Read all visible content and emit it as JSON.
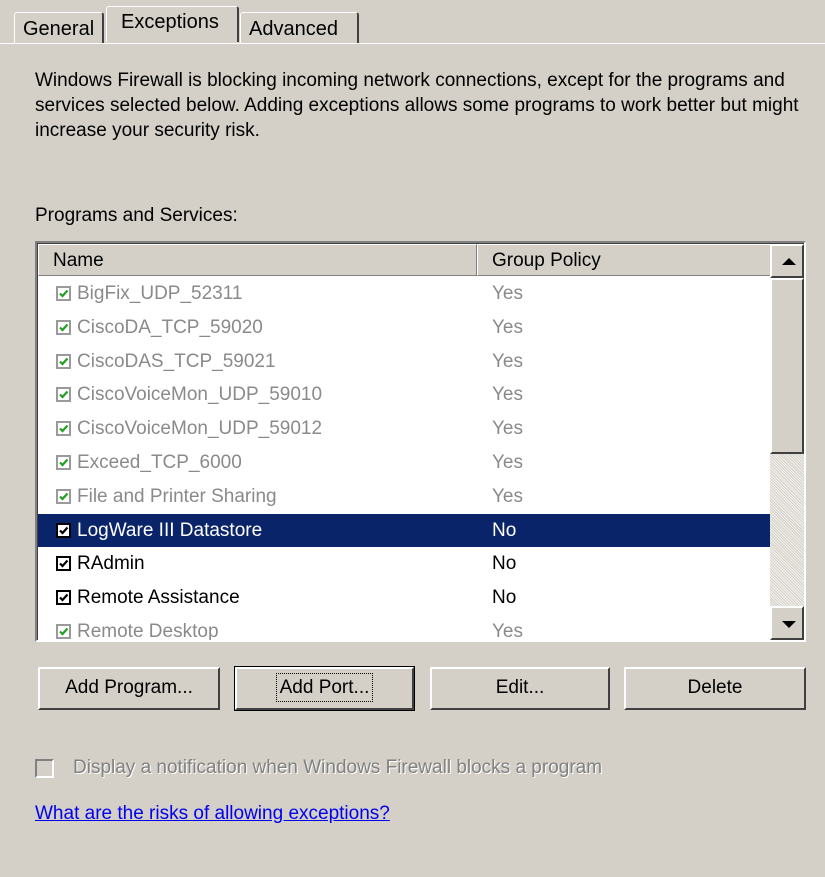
{
  "tabs": [
    {
      "label": "General"
    },
    {
      "label": "Exceptions"
    },
    {
      "label": "Advanced"
    }
  ],
  "description": "Windows Firewall is blocking incoming network connections, except for the programs and services selected below. Adding exceptions allows some programs to work better but might increase your security risk.",
  "programs_label": "Programs and Services:",
  "columns": {
    "name": "Name",
    "group_policy": "Group Policy"
  },
  "rows": [
    {
      "name": "BigFix_UDP_52311",
      "group_policy": "Yes",
      "checked": true,
      "state": "dim"
    },
    {
      "name": "CiscoDA_TCP_59020",
      "group_policy": "Yes",
      "checked": true,
      "state": "dim"
    },
    {
      "name": "CiscoDAS_TCP_59021",
      "group_policy": "Yes",
      "checked": true,
      "state": "dim"
    },
    {
      "name": "CiscoVoiceMon_UDP_59010",
      "group_policy": "Yes",
      "checked": true,
      "state": "dim"
    },
    {
      "name": "CiscoVoiceMon_UDP_59012",
      "group_policy": "Yes",
      "checked": true,
      "state": "dim"
    },
    {
      "name": "Exceed_TCP_6000",
      "group_policy": "Yes",
      "checked": true,
      "state": "dim"
    },
    {
      "name": "File and Printer Sharing",
      "group_policy": "Yes",
      "checked": true,
      "state": "dim"
    },
    {
      "name": "LogWare III Datastore",
      "group_policy": "No",
      "checked": true,
      "state": "selected"
    },
    {
      "name": "RAdmin",
      "group_policy": "No",
      "checked": true,
      "state": "normal"
    },
    {
      "name": "Remote Assistance",
      "group_policy": "No",
      "checked": true,
      "state": "normal"
    },
    {
      "name": "Remote Desktop",
      "group_policy": "Yes",
      "checked": true,
      "state": "dim"
    }
  ],
  "buttons": {
    "add_program": "Add Program...",
    "add_port": "Add Port...",
    "edit": "Edit...",
    "delete": "Delete"
  },
  "notification": {
    "label": "Display a notification when Windows Firewall blocks a program",
    "checked": false,
    "disabled": true
  },
  "help_link": "What are the risks of allowing exceptions?",
  "colors": {
    "background": "#d4d0c8",
    "selection": "#0a246a",
    "disabled_text": "#8a8a8a",
    "link": "#0000ee",
    "check_green": "#21a121"
  },
  "icons": {
    "scroll_up": "up-arrow-icon",
    "scroll_down": "down-arrow-icon",
    "checkmark": "checkmark-icon"
  }
}
